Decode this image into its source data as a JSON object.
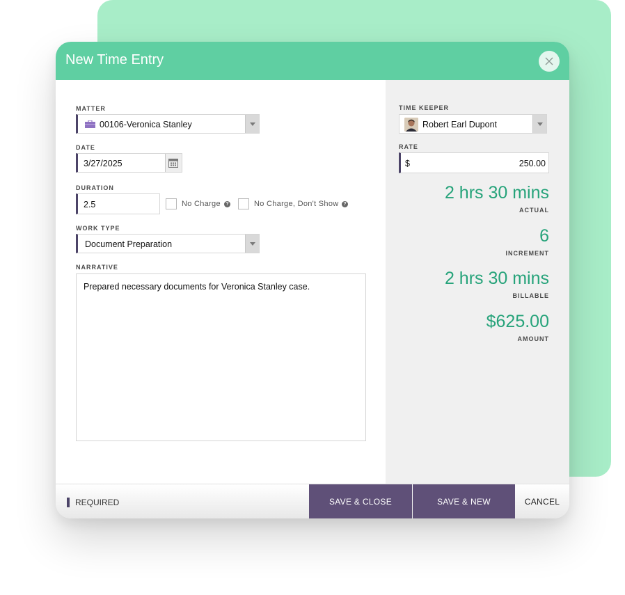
{
  "dialog": {
    "title": "New Time Entry"
  },
  "form": {
    "matter": {
      "label": "MATTER",
      "value": "00106-Veronica Stanley"
    },
    "date": {
      "label": "DATE",
      "value": "3/27/2025"
    },
    "duration": {
      "label": "DURATION",
      "value": "2.5"
    },
    "no_charge": {
      "label": "No Charge",
      "checked": false
    },
    "no_charge_dont_show": {
      "label": "No Charge, Don't Show",
      "checked": false
    },
    "work_type": {
      "label": "WORK TYPE",
      "value": "Document Preparation"
    },
    "narrative": {
      "label": "NARRATIVE",
      "value": "Prepared necessary documents for Veronica Stanley case."
    }
  },
  "side": {
    "time_keeper": {
      "label": "TIME KEEPER",
      "value": "Robert Earl Dupont"
    },
    "rate": {
      "label": "RATE",
      "currency": "$",
      "value": "250.00"
    },
    "actual": {
      "value": "2 hrs 30 mins",
      "label": "ACTUAL"
    },
    "increment": {
      "value": "6",
      "label": "INCREMENT"
    },
    "billable": {
      "value": "2 hrs 30 mins",
      "label": "BILLABLE"
    },
    "amount": {
      "value": "$625.00",
      "label": "AMOUNT"
    }
  },
  "footer": {
    "required_label": "REQUIRED",
    "save_close": "SAVE & CLOSE",
    "save_new": "SAVE & NEW",
    "cancel": "CANCEL"
  },
  "colors": {
    "header": "#5fcfa2",
    "accent_green": "#26a37a",
    "button_purple": "#5f5078",
    "required_marker": "#4c4468",
    "backdrop_card": "#a8edc8"
  },
  "icons": {
    "close": "close-icon",
    "matter": "briefcase-icon",
    "date": "calendar-icon",
    "help": "help-icon",
    "dropdown": "chevron-down-icon"
  }
}
